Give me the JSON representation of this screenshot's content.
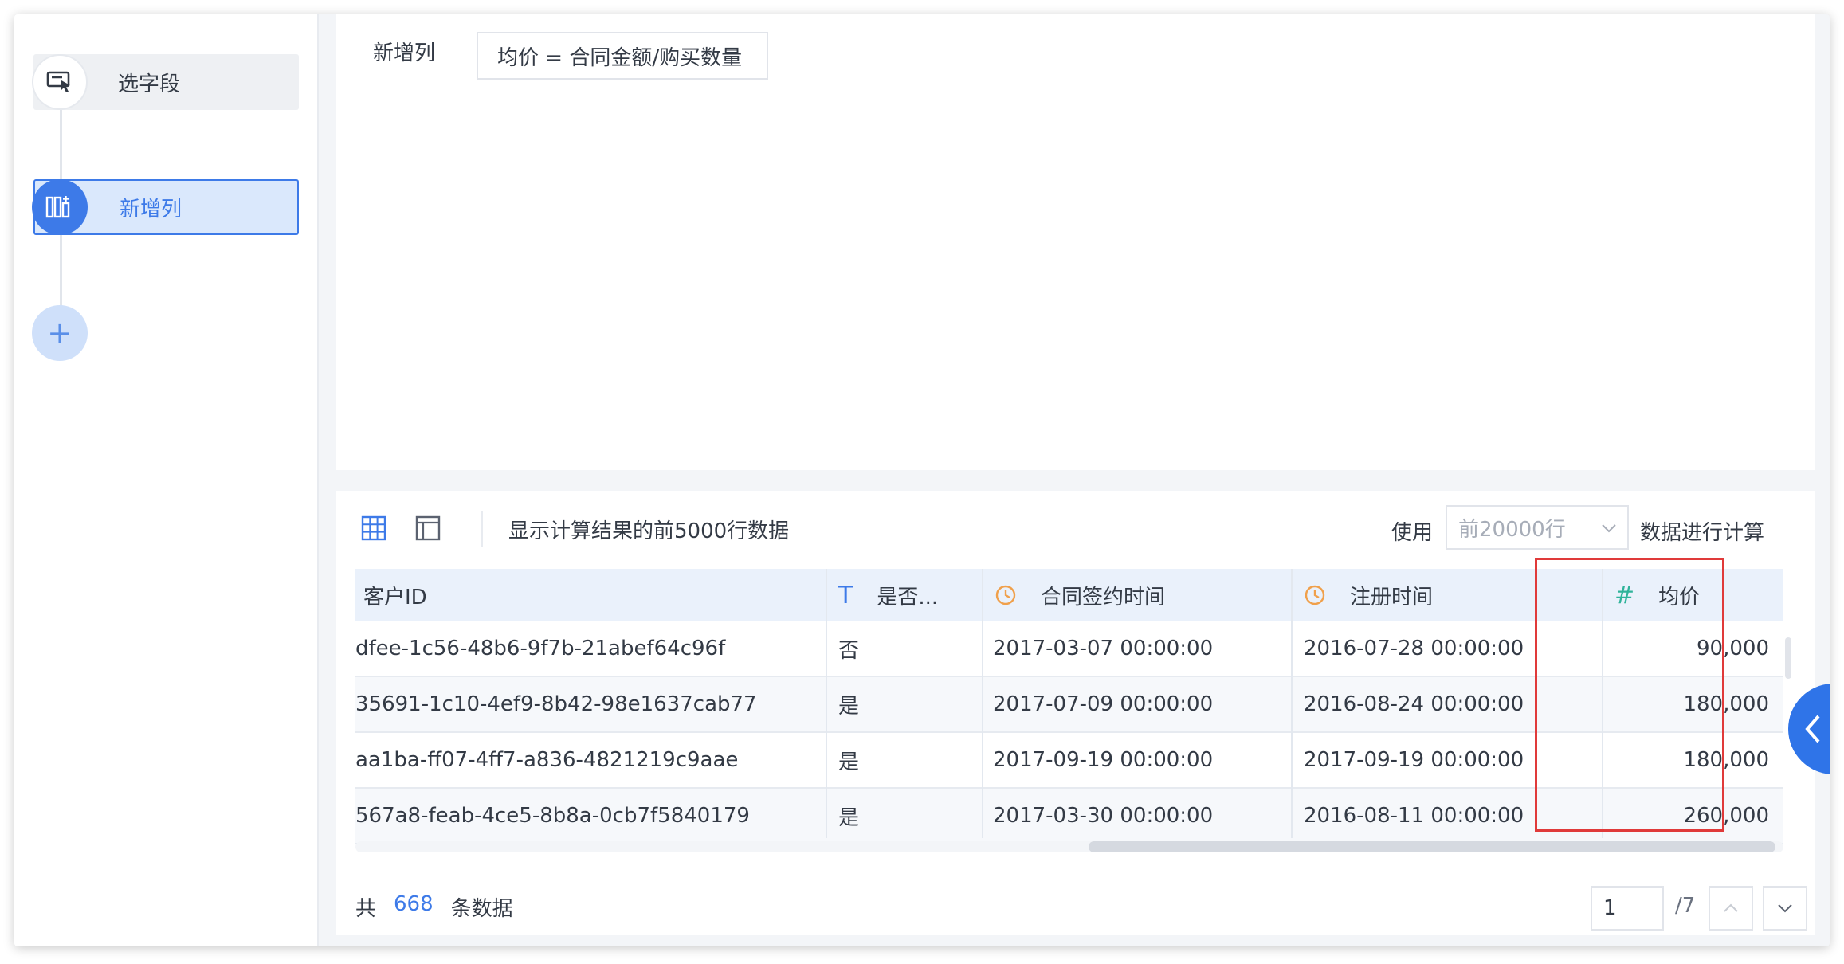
{
  "sidebar": {
    "steps": [
      {
        "label": "选字段",
        "icon": "select-field-icon"
      },
      {
        "label": "新增列",
        "icon": "add-column-icon"
      }
    ],
    "add_icon": "+"
  },
  "config": {
    "label": "新增列",
    "formula": "均价 = 合同金额/购买数量"
  },
  "preview": {
    "info": "显示计算结果的前5000行数据",
    "use_label": "使用",
    "rows_select_value": "前20000行",
    "calc_label": "数据进行计算",
    "columns": [
      {
        "label": "客户ID",
        "type_icon": "",
        "type_glyph": ""
      },
      {
        "label": "是否...",
        "type_icon": "text-type-icon",
        "type_glyph": "T"
      },
      {
        "label": "合同签约时间",
        "type_icon": "clock-icon",
        "type_glyph": ""
      },
      {
        "label": "注册时间",
        "type_icon": "clock-icon",
        "type_glyph": ""
      },
      {
        "label": "均价",
        "type_icon": "number-type-icon",
        "type_glyph": "#"
      }
    ],
    "rows": [
      [
        "dfee-1c56-48b6-9f7b-21abef64c96f",
        "否",
        "2017-03-07 00:00:00",
        "2016-07-28 00:00:00",
        "90,000"
      ],
      [
        "35691-1c10-4ef9-8b42-98e1637cab77",
        "是",
        "2017-07-09 00:00:00",
        "2016-08-24 00:00:00",
        "180,000"
      ],
      [
        "aa1ba-ff07-4ff7-a836-4821219c9aae",
        "是",
        "2017-09-19 00:00:00",
        "2017-09-19 00:00:00",
        "180,000"
      ],
      [
        "567a8-feab-4ce5-8b8a-0cb7f5840179",
        "是",
        "2017-03-30 00:00:00",
        "2016-08-11 00:00:00",
        "260,000"
      ]
    ],
    "footer": {
      "prefix": "共",
      "count": "668",
      "suffix": "条数据",
      "page_value": "1",
      "page_total": "/7"
    }
  },
  "colors": {
    "accent": "#3d7ae8",
    "header_bg": "#eaf1fb",
    "highlight": "#e03a3a",
    "clock": "#f0a04b",
    "type_text": "#3d7ae8",
    "type_number": "#2fb39a"
  }
}
